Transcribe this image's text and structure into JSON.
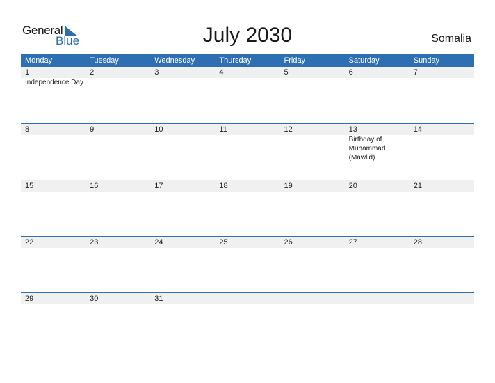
{
  "logo": {
    "word1": "General",
    "word2": "Blue"
  },
  "title": "July 2030",
  "country": "Somalia",
  "days": [
    "Monday",
    "Tuesday",
    "Wednesday",
    "Thursday",
    "Friday",
    "Saturday",
    "Sunday"
  ],
  "weeks": [
    [
      {
        "d": "1",
        "ev": "Independence Day"
      },
      {
        "d": "2",
        "ev": ""
      },
      {
        "d": "3",
        "ev": ""
      },
      {
        "d": "4",
        "ev": ""
      },
      {
        "d": "5",
        "ev": ""
      },
      {
        "d": "6",
        "ev": ""
      },
      {
        "d": "7",
        "ev": ""
      }
    ],
    [
      {
        "d": "8",
        "ev": ""
      },
      {
        "d": "9",
        "ev": ""
      },
      {
        "d": "10",
        "ev": ""
      },
      {
        "d": "11",
        "ev": ""
      },
      {
        "d": "12",
        "ev": ""
      },
      {
        "d": "13",
        "ev": "Birthday of Muhammad (Mawlid)"
      },
      {
        "d": "14",
        "ev": ""
      }
    ],
    [
      {
        "d": "15",
        "ev": ""
      },
      {
        "d": "16",
        "ev": ""
      },
      {
        "d": "17",
        "ev": ""
      },
      {
        "d": "18",
        "ev": ""
      },
      {
        "d": "19",
        "ev": ""
      },
      {
        "d": "20",
        "ev": ""
      },
      {
        "d": "21",
        "ev": ""
      }
    ],
    [
      {
        "d": "22",
        "ev": ""
      },
      {
        "d": "23",
        "ev": ""
      },
      {
        "d": "24",
        "ev": ""
      },
      {
        "d": "25",
        "ev": ""
      },
      {
        "d": "26",
        "ev": ""
      },
      {
        "d": "27",
        "ev": ""
      },
      {
        "d": "28",
        "ev": ""
      }
    ],
    [
      {
        "d": "29",
        "ev": ""
      },
      {
        "d": "30",
        "ev": ""
      },
      {
        "d": "31",
        "ev": ""
      },
      {
        "d": "",
        "ev": ""
      },
      {
        "d": "",
        "ev": ""
      },
      {
        "d": "",
        "ev": ""
      },
      {
        "d": "",
        "ev": ""
      }
    ]
  ],
  "colors": {
    "accent": "#2e6fb4",
    "band": "#f0f0f0"
  }
}
